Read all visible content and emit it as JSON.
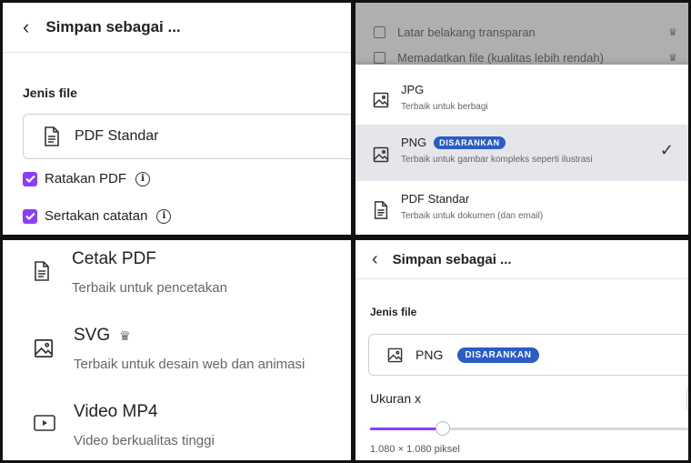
{
  "panel1": {
    "title": "Simpan sebagai ...",
    "file_type_label": "Jenis file",
    "selected_file": "PDF Standar",
    "checkboxes": [
      {
        "label": "Ratakan PDF",
        "checked": true
      },
      {
        "label": "Sertakan catatan",
        "checked": true
      }
    ]
  },
  "panel2": {
    "dimmed_options": [
      {
        "label": "Latar belakang transparan"
      },
      {
        "label": "Memadatkan file (kualitas lebih rendah)"
      }
    ],
    "options": [
      {
        "title": "JPG",
        "desc": "Terbaik untuk berbagi",
        "icon": "image-icon"
      },
      {
        "title": "PNG",
        "desc": "Terbaik untuk gambar kompleks seperti ilustrasi",
        "badge": "DISARANKAN",
        "selected": true,
        "icon": "image-icon"
      },
      {
        "title": "PDF Standar",
        "desc": "Terbaik untuk dokumen (dan email)",
        "icon": "document-icon"
      }
    ],
    "crown_glyph": "♛",
    "check_glyph": "✓"
  },
  "panel3": {
    "options": [
      {
        "title": "Cetak PDF",
        "desc": "Terbaik untuk pencetakan",
        "icon": "document-icon"
      },
      {
        "title": "SVG",
        "desc": "Terbaik untuk desain web dan animasi",
        "icon": "image-icon",
        "premium": true
      },
      {
        "title": "Video MP4",
        "desc": "Video berkualitas tinggi",
        "icon": "video-icon"
      }
    ],
    "crown_glyph": "♛"
  },
  "panel4": {
    "title": "Simpan sebagai ...",
    "file_type_label": "Jenis file",
    "selected_file": "PNG",
    "badge": "DISARANKAN",
    "size_label": "Ukuran x",
    "slider_fraction": 0.2,
    "size_value": "1.080 × 1.080 piksel"
  },
  "colors": {
    "accent_purple": "#8b3dff",
    "badge_blue": "#2b5cc7",
    "selected_row_bg": "#e4e6eb"
  }
}
